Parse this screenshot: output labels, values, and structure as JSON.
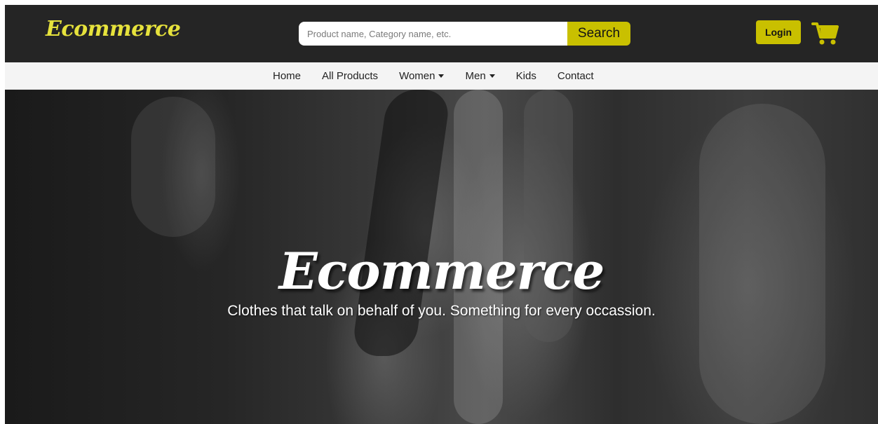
{
  "header": {
    "brand": "Ecommerce",
    "search": {
      "placeholder": "Product name, Category name, etc.",
      "value": "",
      "button_label": "Search"
    },
    "login_label": "Login",
    "cart_icon": "shopping-cart-icon"
  },
  "nav": {
    "items": [
      {
        "label": "Home",
        "dropdown": false
      },
      {
        "label": "All Products",
        "dropdown": false
      },
      {
        "label": "Women",
        "dropdown": true
      },
      {
        "label": "Men",
        "dropdown": true
      },
      {
        "label": "Kids",
        "dropdown": false
      },
      {
        "label": "Contact",
        "dropdown": false
      }
    ]
  },
  "hero": {
    "title": "Ecommerce",
    "subtitle": "Clothes that talk on behalf of you. Something for every occassion."
  },
  "colors": {
    "header_bg": "#252525",
    "brand": "#e6e23c",
    "accent": "#c9c000",
    "nav_bg": "#f4f4f4"
  }
}
